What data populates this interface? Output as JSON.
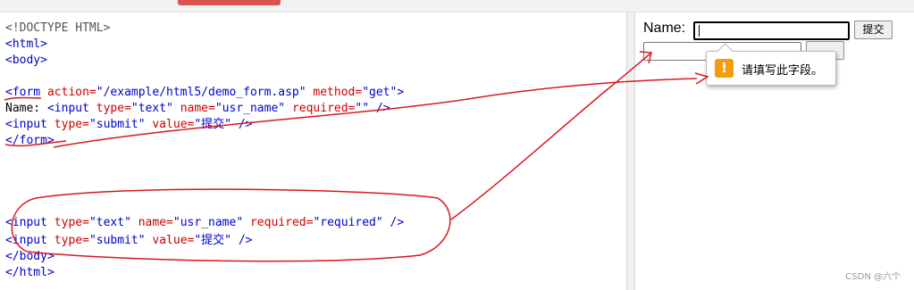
{
  "code": {
    "doctype": "<!DOCTYPE HTML>",
    "html_open": "<html>",
    "body_open": "<body>",
    "form_open": {
      "tag": "<form",
      "attr1": " action=",
      "val1": "\"/example/html5/demo_form.asp\"",
      "attr2": " method=",
      "val2": "\"get\"",
      "close": ">"
    },
    "line_name": {
      "text": "Name: ",
      "tag": "<input",
      "a1": " type=",
      "v1": "\"text\"",
      "a2": " name=",
      "v2": "\"usr_name\"",
      "a3": " required=",
      "v3": "\"\"",
      "close": " />"
    },
    "line_submit1": {
      "tag": "<input",
      "a1": " type=",
      "v1": "\"submit\"",
      "a2": " value=",
      "v2": "\"提交\"",
      "close": " />"
    },
    "form_close": "</form>",
    "line_input2": {
      "tag": "<input",
      "a1": " type=",
      "v1": "\"text\"",
      "a2": " name=",
      "v2": "\"usr_name\"",
      "a3": " required=",
      "v3": "\"required\"",
      "close": " />"
    },
    "line_submit2": {
      "tag": "<input",
      "a1": " type=",
      "v1": "\"submit\"",
      "a2": " value=",
      "v2": "\"提交\"",
      "close": " />"
    },
    "body_close": "</body>",
    "html_close": "</html>"
  },
  "preview": {
    "name_label": "Name:",
    "name_value": "",
    "submit_label": "提交",
    "second_value": "",
    "tooltip_message": "请填写此字段。",
    "tooltip_icon": "!"
  },
  "watermark": "CSDN @六个",
  "colors": {
    "tag": "#0000cc",
    "attr": "#cc0000",
    "annotation": "#d9181e",
    "warning": "#f29d10"
  }
}
